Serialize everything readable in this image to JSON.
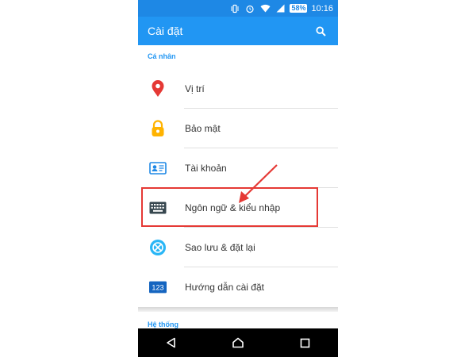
{
  "status_bar": {
    "battery": "58%",
    "time": "10:16",
    "icons": [
      "vibrate-icon",
      "alarm-icon",
      "wifi-icon",
      "signal-icon",
      "battery-icon"
    ]
  },
  "app_bar": {
    "title": "Cài đặt",
    "search_icon": "search-icon"
  },
  "sections": [
    {
      "header": "Cá nhân",
      "items": [
        {
          "label": "Vị trí",
          "icon": "location-pin-icon"
        },
        {
          "label": "Bảo mật",
          "icon": "lock-icon"
        },
        {
          "label": "Tài khoản",
          "icon": "account-card-icon"
        },
        {
          "label": "Ngôn ngữ & kiểu nhập",
          "icon": "keyboard-icon"
        },
        {
          "label": "Sao lưu & đặt lại",
          "icon": "backup-icon"
        },
        {
          "label": "Hướng dẫn cài đặt",
          "icon": "setup-guide-icon",
          "icon_text": "123"
        }
      ]
    },
    {
      "header": "Hệ thống",
      "items": []
    }
  ],
  "nav_bar": {
    "icons": [
      "back-icon",
      "home-icon",
      "recents-icon"
    ]
  },
  "colors": {
    "status_bar": "#1e88e5",
    "app_bar": "#2196f3",
    "accent": "#2196f3",
    "annotation": "#e53935"
  }
}
